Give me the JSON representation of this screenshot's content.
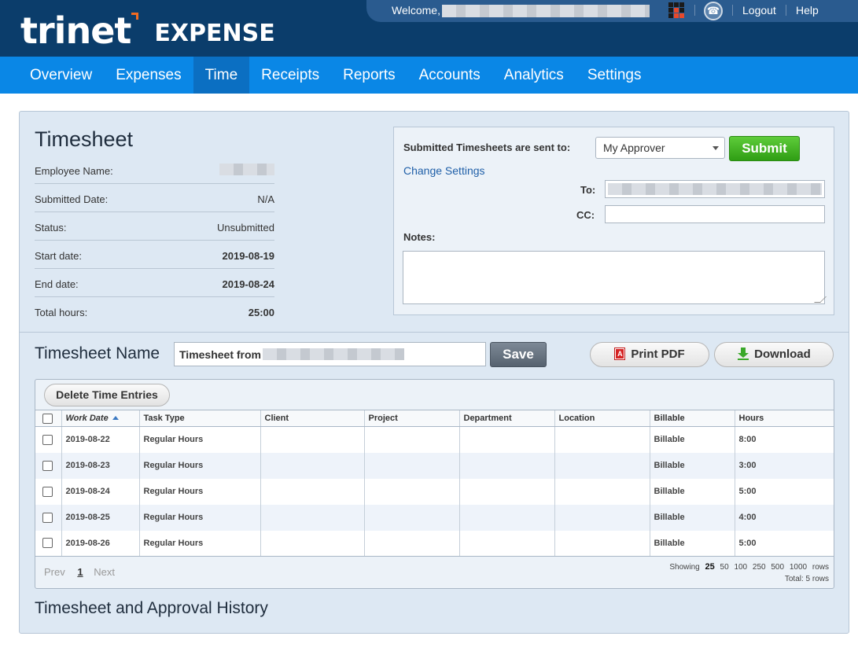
{
  "brand": {
    "logo_text": "trinet",
    "product": "EXPENSE",
    "accent": "#f26b21"
  },
  "userbar": {
    "welcome": "Welcome,",
    "logout": "Logout",
    "help": "Help"
  },
  "nav": {
    "items": [
      "Overview",
      "Expenses",
      "Time",
      "Receipts",
      "Reports",
      "Accounts",
      "Analytics",
      "Settings"
    ],
    "active": "Time"
  },
  "timesheet": {
    "title": "Timesheet",
    "employee_label": "Employee Name:",
    "submitted_label": "Submitted Date:",
    "submitted_value": "N/A",
    "status_label": "Status:",
    "status_value": "Unsubmitted",
    "start_label": "Start date:",
    "start_value": "2019-08-19",
    "end_label": "End date:",
    "end_value": "2019-08-24",
    "total_label": "Total hours:",
    "total_value": "25:00"
  },
  "submit": {
    "sent_label": "Submitted Timesheets are sent to:",
    "approver_selected": "My Approver",
    "submit_button": "Submit",
    "change_settings": "Change Settings",
    "to_label": "To:",
    "cc_label": "CC:",
    "cc_value": "",
    "notes_label": "Notes:",
    "notes_value": ""
  },
  "name_bar": {
    "label": "Timesheet Name",
    "input_prefix": "Timesheet from",
    "save": "Save",
    "print_pdf": "Print PDF",
    "download": "Download"
  },
  "grid": {
    "delete_button": "Delete Time Entries",
    "columns": [
      "Work Date",
      "Task Type",
      "Client",
      "Project",
      "Department",
      "Location",
      "Billable",
      "Hours"
    ],
    "rows": [
      {
        "date": "2019-08-22",
        "task": "Regular Hours",
        "client": "",
        "project": "",
        "department": "",
        "location": "",
        "billable": "Billable",
        "hours": "8:00"
      },
      {
        "date": "2019-08-23",
        "task": "Regular Hours",
        "client": "",
        "project": "",
        "department": "",
        "location": "",
        "billable": "Billable",
        "hours": "3:00"
      },
      {
        "date": "2019-08-24",
        "task": "Regular Hours",
        "client": "",
        "project": "",
        "department": "",
        "location": "",
        "billable": "Billable",
        "hours": "5:00"
      },
      {
        "date": "2019-08-25",
        "task": "Regular Hours",
        "client": "",
        "project": "",
        "department": "",
        "location": "",
        "billable": "Billable",
        "hours": "4:00"
      },
      {
        "date": "2019-08-26",
        "task": "Regular Hours",
        "client": "",
        "project": "",
        "department": "",
        "location": "",
        "billable": "Billable",
        "hours": "5:00"
      }
    ],
    "pager": {
      "prev": "Prev",
      "current": "1",
      "next": "Next"
    },
    "showing_label": "Showing",
    "page_sizes": [
      "25",
      "50",
      "100",
      "250",
      "500",
      "1000"
    ],
    "page_size_selected": "25",
    "rows_label": "rows",
    "total": "Total: 5 rows"
  },
  "history": {
    "title": "Timesheet and Approval History"
  }
}
